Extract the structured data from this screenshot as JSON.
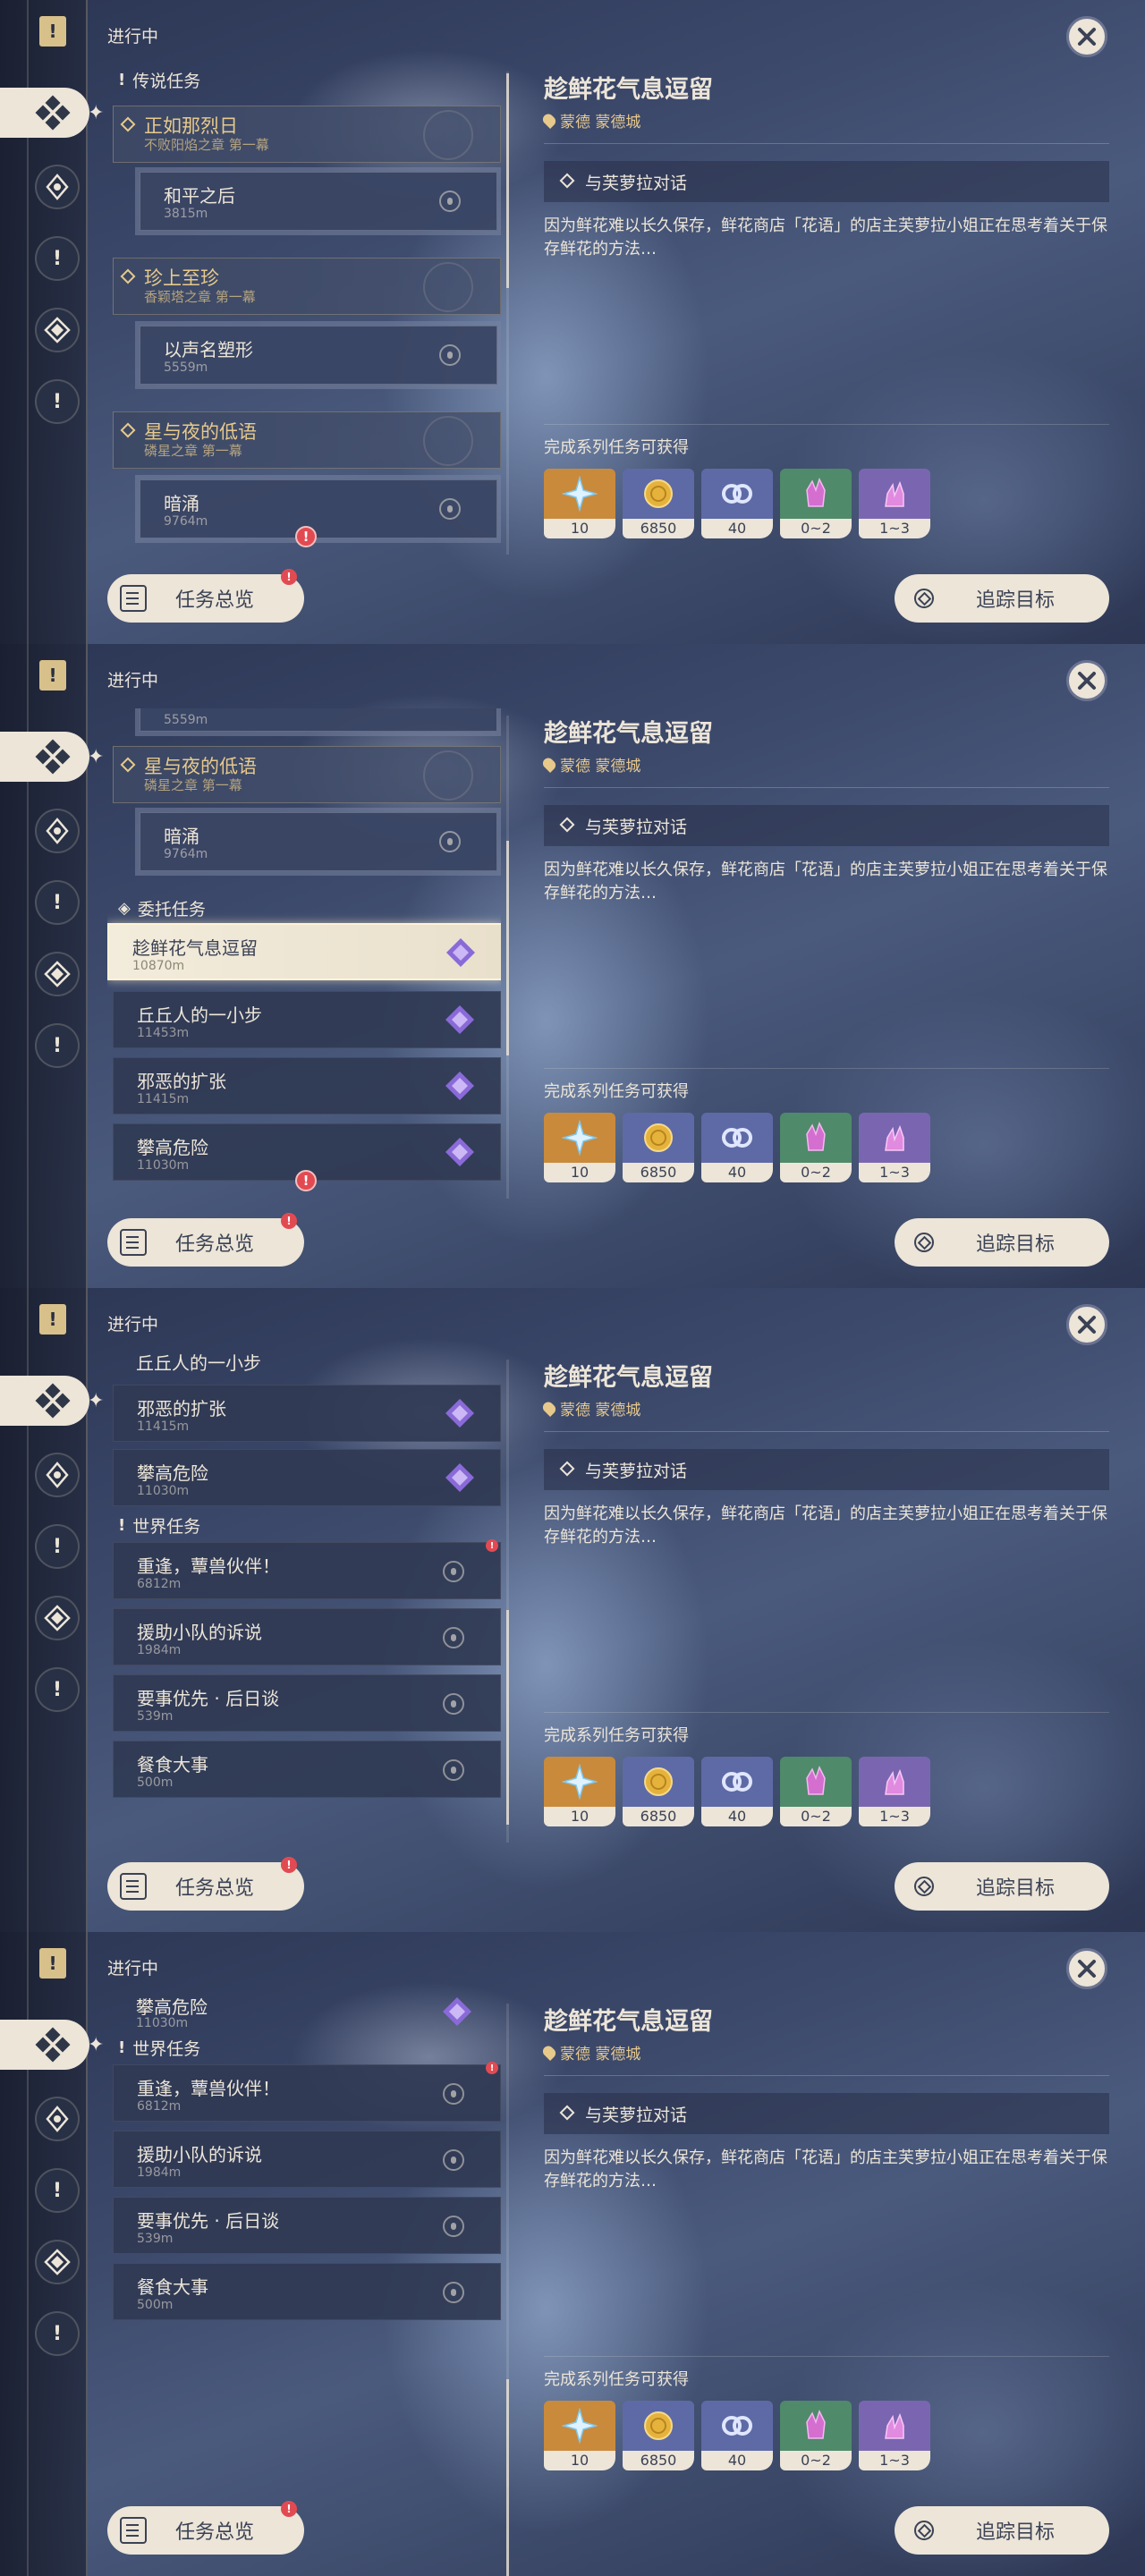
{
  "sidebar": {
    "flag_icon": "quest-flag-icon"
  },
  "header": {
    "in_progress": "进行中"
  },
  "detail": {
    "title": "趁鲜花气息逗留",
    "location": "蒙德 蒙德城",
    "step": "与芙萝拉对话",
    "description": "因为鲜花难以长久保存，鲜花商店「花语」的店主芙萝拉小姐正在思考着关于保存鲜花的方法…",
    "reward_label": "完成系列任务可获得",
    "rewards": [
      {
        "icon": "primogem-icon",
        "count": "10",
        "color": "#c98a3c"
      },
      {
        "icon": "mora-icon",
        "count": "6850",
        "color": "#5e6aa6"
      },
      {
        "icon": "companionship-exp-icon",
        "count": "40",
        "color": "#5e6aa6"
      },
      {
        "icon": "crystal-chunk-icon",
        "count": "0~2",
        "color": "#4f8a6a"
      },
      {
        "icon": "crystal-ore-icon",
        "count": "1~3",
        "color": "#7a66b0"
      }
    ],
    "track_label": "追踪目标"
  },
  "footer": {
    "overview_label": "任务总览"
  },
  "sections": {
    "legend": "传说任务",
    "commission": "委托任务",
    "world": "世界任务"
  },
  "legend_quests": [
    {
      "chapter": "正如那烈日",
      "act": "不败阳焰之章 第一幕",
      "quest": "和平之后",
      "distance": "3815m"
    },
    {
      "chapter": "珍上至珍",
      "act": "香颖塔之章 第一幕",
      "quest": "以声名塑形",
      "distance": "5559m"
    },
    {
      "chapter": "星与夜的低语",
      "act": "磷星之章 第一幕",
      "quest": "暗涌",
      "distance": "9764m"
    }
  ],
  "commission_quests": [
    {
      "name": "趁鲜花气息逗留",
      "distance": "10870m"
    },
    {
      "name": "丘丘人的一小步",
      "distance": "11453m"
    },
    {
      "name": "邪恶的扩张",
      "distance": "11415m"
    },
    {
      "name": "攀高危险",
      "distance": "11030m"
    }
  ],
  "world_quests": [
    {
      "name": "重逢，蕈兽伙伴！",
      "distance": "6812m"
    },
    {
      "name": "援助小队的诉说",
      "distance": "1984m"
    },
    {
      "name": "要事优先 · 后日谈",
      "distance": "539m"
    },
    {
      "name": "餐食大事",
      "distance": "500m"
    }
  ],
  "partial": {
    "top_distance": "5559m",
    "top_commission": "丘丘人的一小步"
  },
  "colors": {
    "accent_gold": "#e7c98c",
    "cream": "#ece5d8",
    "alert": "#e24a52",
    "commission_purple": "#8a6ad8"
  }
}
